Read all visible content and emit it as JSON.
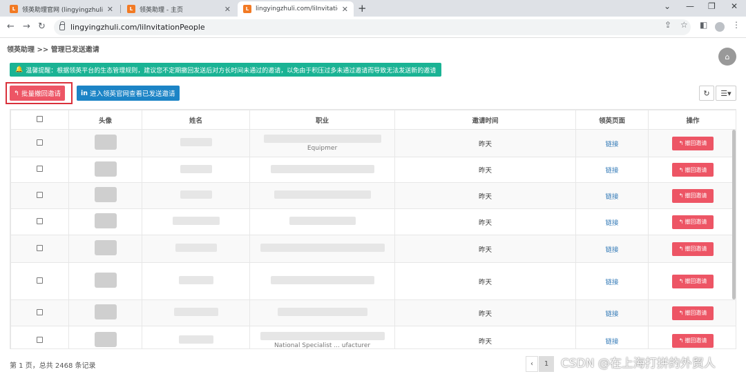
{
  "tabs": [
    {
      "label": "领英助理官网 (lingyingzhuli.co",
      "icon": "ly-favicon"
    },
    {
      "label": "领英助理 - 主页",
      "icon": "ly-favicon"
    },
    {
      "label": "lingyingzhuli.com/liInvitationP",
      "icon": "ly-favicon"
    }
  ],
  "url": "lingyingzhuli.com/liInvitationPeople",
  "breadcrumb": "领英助理 >> 管理已发送邀请",
  "notice": "温馨提醒：根据领英平台的生态管理规则，建议您不定期撤回发送后对方长时间未通过的邀请，以免由于积压过多未通过邀请而导致无法发送新的邀请",
  "actions": {
    "batch_revoke": "批量撤回邀请",
    "view_official": "进入领英官网查看已发送邀请"
  },
  "table": {
    "headers": [
      "头像",
      "姓名",
      "职业",
      "邀请时间",
      "领英页面",
      "操作"
    ],
    "rows": [
      {
        "occupation_fragment": "Equipmer",
        "time": "昨天",
        "link": "链接",
        "action": "撤回邀请"
      },
      {
        "occupation_fragment": "",
        "time": "昨天",
        "link": "链接",
        "action": "撤回邀请"
      },
      {
        "occupation_fragment": "",
        "time": "昨天",
        "link": "链接",
        "action": "撤回邀请"
      },
      {
        "occupation_fragment": "",
        "time": "昨天",
        "link": "链接",
        "action": "撤回邀请"
      },
      {
        "occupation_fragment": "",
        "time": "昨天",
        "link": "链接",
        "action": "撤回邀请"
      },
      {
        "occupation_fragment": "",
        "time": "昨天",
        "link": "链接",
        "action": "撤回邀请"
      },
      {
        "occupation_fragment": "",
        "time": "昨天",
        "link": "链接",
        "action": "撤回邀请"
      },
      {
        "occupation_fragment": "National Specialist ... ufacturer",
        "time": "昨天",
        "link": "链接",
        "action": "撤回邀请"
      }
    ]
  },
  "footer": {
    "page_info": "第 1 页，总共 2468 条记录",
    "pager": [
      "‹",
      "1"
    ]
  },
  "watermark": "CSDN @在上海打拼的外贸人"
}
